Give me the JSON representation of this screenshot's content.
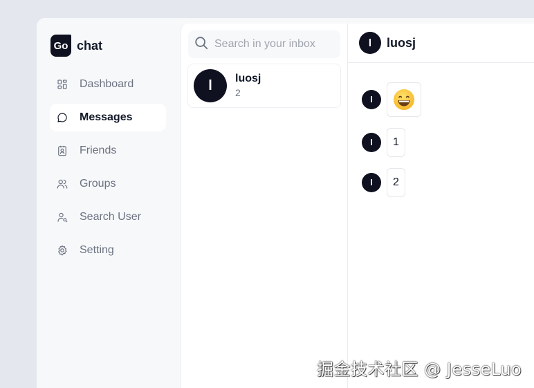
{
  "brand": {
    "logo_text": "Go",
    "name": "chat"
  },
  "nav": {
    "items": [
      {
        "label": "Dashboard",
        "icon": "dashboard-icon",
        "active": false
      },
      {
        "label": "Messages",
        "icon": "message-icon",
        "active": true
      },
      {
        "label": "Friends",
        "icon": "contact-card-icon",
        "active": false
      },
      {
        "label": "Groups",
        "icon": "users-icon",
        "active": false
      },
      {
        "label": "Search User",
        "icon": "user-search-icon",
        "active": false
      },
      {
        "label": "Setting",
        "icon": "gear-icon",
        "active": false
      }
    ]
  },
  "search": {
    "placeholder": "Search in your inbox",
    "value": ""
  },
  "conversations": [
    {
      "avatar_initial": "l",
      "name": "luosj",
      "preview": "2"
    }
  ],
  "chat": {
    "header": {
      "avatar_initial": "l",
      "name": "luosj"
    },
    "messages": [
      {
        "avatar_initial": "l",
        "text": "😄",
        "type": "emoji"
      },
      {
        "avatar_initial": "l",
        "text": "1",
        "type": "text"
      },
      {
        "avatar_initial": "l",
        "text": "2",
        "type": "text"
      }
    ]
  },
  "watermark": "掘金技术社区 @ JesseLuo",
  "colors": {
    "accent": "#0f1020",
    "background": "#e4e7ed",
    "sidebar": "#f7f8fa"
  }
}
